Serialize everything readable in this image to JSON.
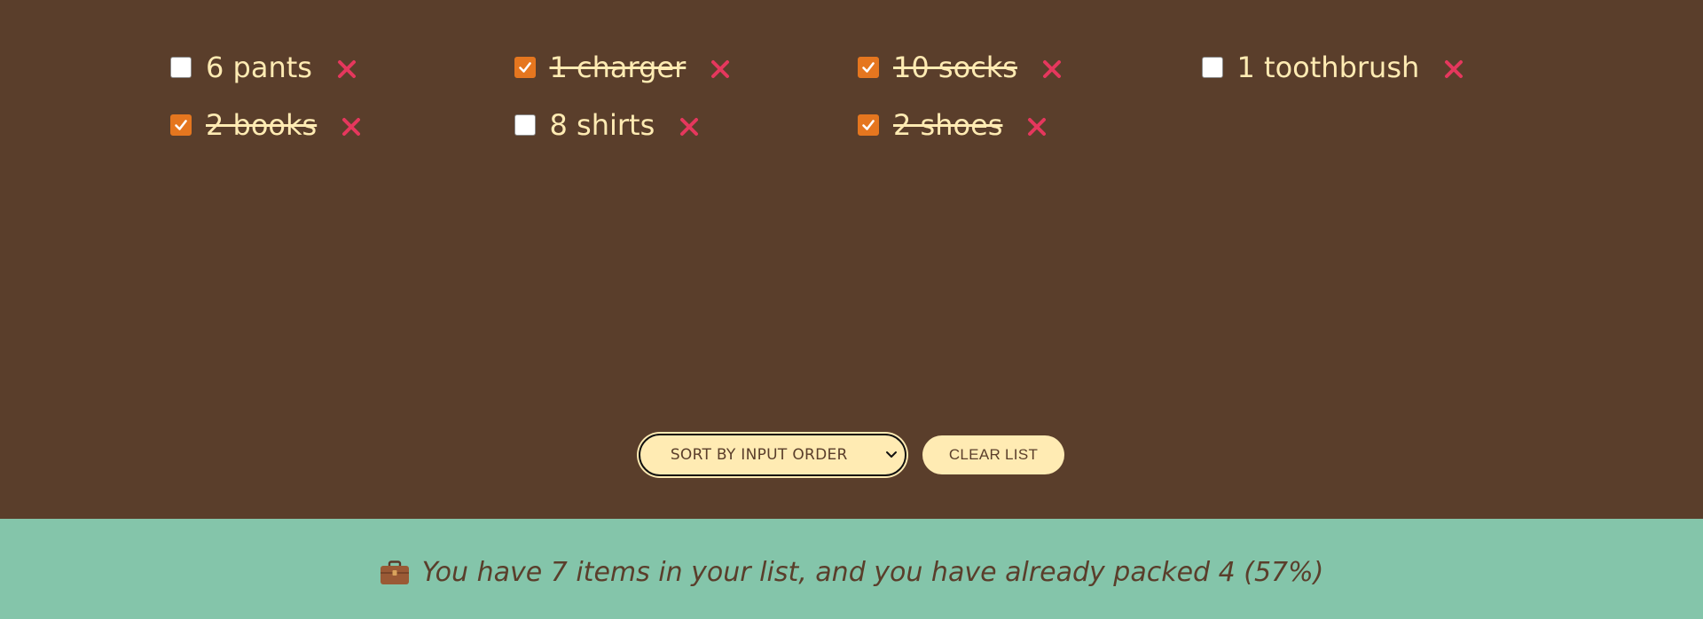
{
  "colors": {
    "list_background": "#5a3e2b",
    "footer_background": "#84c5aa",
    "item_text": "#ffebb3",
    "checked_box": "#e5761f",
    "delete_icon": "#e5375d",
    "button_background": "#ffebb3",
    "button_text": "#5a3e2b"
  },
  "items": [
    {
      "label": "6 pants",
      "packed": false,
      "delete_icon": "close-icon"
    },
    {
      "label": "1 charger",
      "packed": true,
      "delete_icon": "close-icon"
    },
    {
      "label": "10 socks",
      "packed": true,
      "delete_icon": "close-icon"
    },
    {
      "label": "1 toothbrush",
      "packed": false,
      "delete_icon": "close-icon"
    },
    {
      "label": "2 books",
      "packed": true,
      "delete_icon": "close-icon"
    },
    {
      "label": "8 shirts",
      "packed": false,
      "delete_icon": "close-icon"
    },
    {
      "label": "2 shoes",
      "packed": true,
      "delete_icon": "close-icon"
    }
  ],
  "actions": {
    "sort_value": "SORT BY INPUT ORDER",
    "clear_label": "CLEAR LIST"
  },
  "footer": {
    "icon": "briefcase-icon",
    "stats_text": "You have 7 items in your list, and you have already packed 4 (57%)"
  }
}
